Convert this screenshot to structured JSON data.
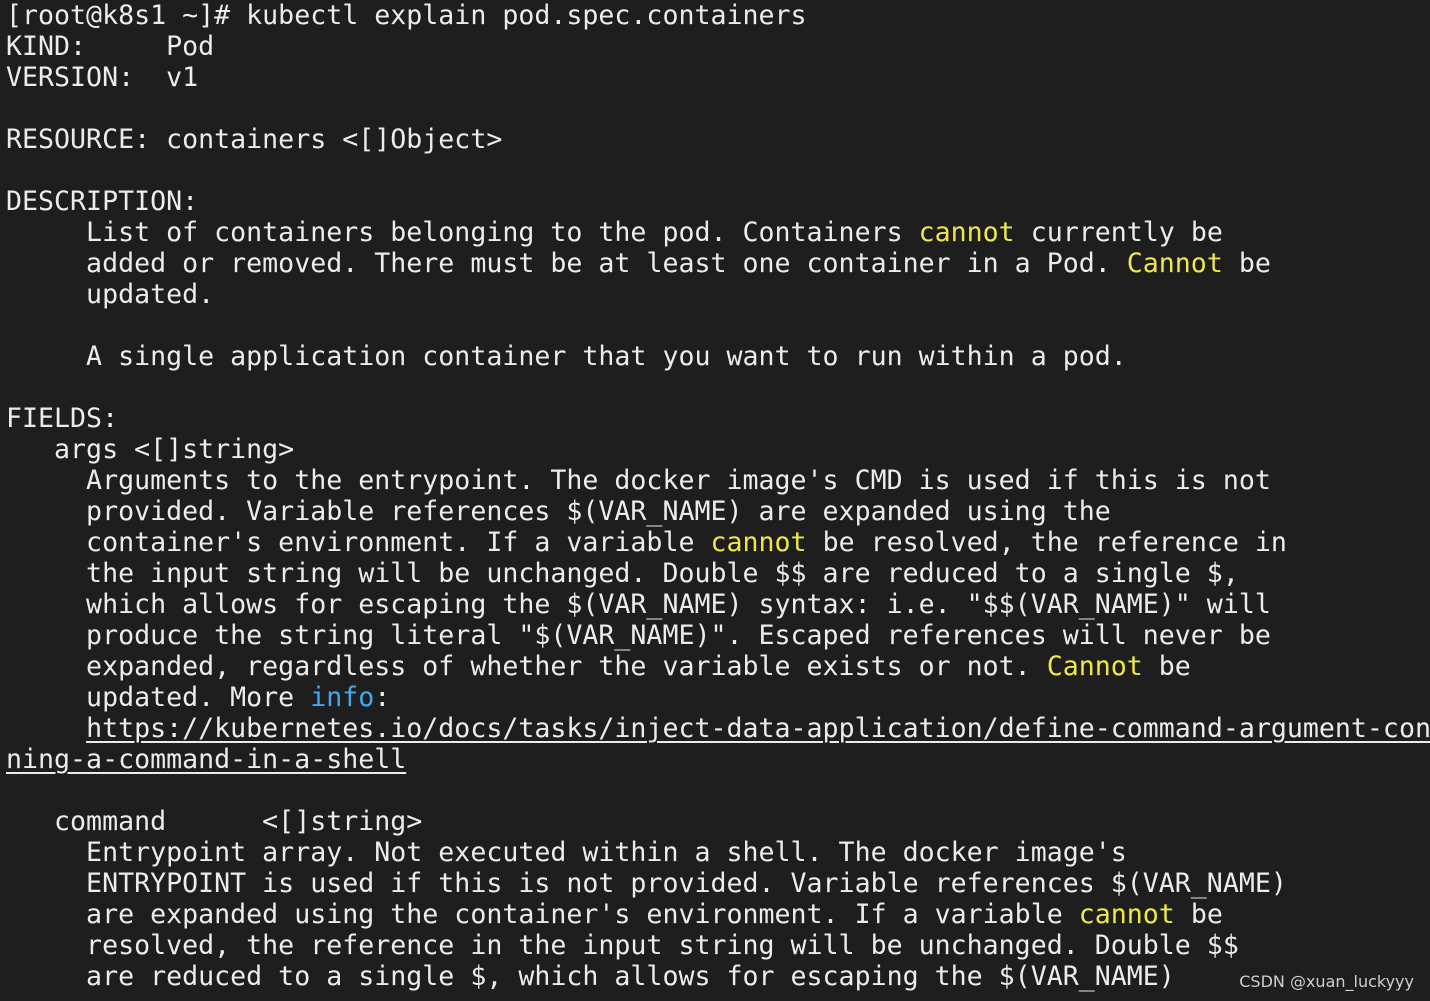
{
  "colors": {
    "background": "#1e1e1e",
    "foreground": "#ececec",
    "highlight_yellow": "#f0e64a",
    "highlight_blue": "#3fa9f5"
  },
  "terminal": {
    "lines": [
      {
        "segments": [
          {
            "text": "[root@k8s1 ~]# kubectl explain pod.spec.containers"
          }
        ]
      },
      {
        "segments": [
          {
            "text": "KIND:     Pod"
          }
        ]
      },
      {
        "segments": [
          {
            "text": "VERSION:  v1"
          }
        ]
      },
      {
        "segments": []
      },
      {
        "segments": [
          {
            "text": "RESOURCE: containers <[]Object>"
          }
        ]
      },
      {
        "segments": []
      },
      {
        "segments": [
          {
            "text": "DESCRIPTION:"
          }
        ]
      },
      {
        "segments": [
          {
            "text": "     List of containers belonging to the pod. Containers "
          },
          {
            "text": "cannot",
            "hl": "yellow"
          },
          {
            "text": " currently be"
          }
        ]
      },
      {
        "segments": [
          {
            "text": "     added or removed. There must be at least one container in a Pod. "
          },
          {
            "text": "Cannot",
            "hl": "yellow"
          },
          {
            "text": " be"
          }
        ]
      },
      {
        "segments": [
          {
            "text": "     updated."
          }
        ]
      },
      {
        "segments": []
      },
      {
        "segments": [
          {
            "text": "     A single application container that you want to run within a pod."
          }
        ]
      },
      {
        "segments": []
      },
      {
        "segments": [
          {
            "text": "FIELDS:"
          }
        ]
      },
      {
        "segments": [
          {
            "text": "   args <[]string>"
          }
        ]
      },
      {
        "segments": [
          {
            "text": "     Arguments to the entrypoint. The docker image's CMD is used if this is not"
          }
        ]
      },
      {
        "segments": [
          {
            "text": "     provided. Variable references $(VAR_NAME) are expanded using the"
          }
        ]
      },
      {
        "segments": [
          {
            "text": "     container's environment. If a variable "
          },
          {
            "text": "cannot",
            "hl": "yellow"
          },
          {
            "text": " be resolved, the reference in"
          }
        ]
      },
      {
        "segments": [
          {
            "text": "     the input string will be unchanged. Double $$ are reduced to a single $,"
          }
        ]
      },
      {
        "segments": [
          {
            "text": "     which allows for escaping the $(VAR_NAME) syntax: i.e. \"$$(VAR_NAME)\" will"
          }
        ]
      },
      {
        "segments": [
          {
            "text": "     produce the string literal \"$(VAR_NAME)\". Escaped references will never be"
          }
        ]
      },
      {
        "segments": [
          {
            "text": "     expanded, regardless of whether the variable exists or not. "
          },
          {
            "text": "Cannot",
            "hl": "yellow"
          },
          {
            "text": " be"
          }
        ]
      },
      {
        "segments": [
          {
            "text": "     updated. More "
          },
          {
            "text": "info",
            "hl": "blue"
          },
          {
            "text": ":"
          }
        ]
      },
      {
        "segments": [
          {
            "text": "     "
          },
          {
            "text": "https://kubernetes.io/docs/tasks/inject-data-application/define-command-argument-con",
            "link": true
          }
        ]
      },
      {
        "segments": [
          {
            "text": "ning-a-command-in-a-shell",
            "link": true
          }
        ]
      },
      {
        "segments": []
      },
      {
        "segments": [
          {
            "text": "   command      <[]string>"
          }
        ]
      },
      {
        "segments": [
          {
            "text": "     Entrypoint array. Not executed within a shell. The docker image's"
          }
        ]
      },
      {
        "segments": [
          {
            "text": "     ENTRYPOINT is used if this is not provided. Variable references $(VAR_NAME)"
          }
        ]
      },
      {
        "segments": [
          {
            "text": "     are expanded using the container's environment. If a variable "
          },
          {
            "text": "cannot",
            "hl": "yellow"
          },
          {
            "text": " be"
          }
        ]
      },
      {
        "segments": [
          {
            "text": "     resolved, the reference in the input string will be unchanged. Double $$"
          }
        ]
      },
      {
        "segments": [
          {
            "text": "     are reduced to a single $, which allows for escaping the $(VAR_NAME)"
          }
        ]
      }
    ]
  },
  "watermark": "CSDN @xuan_luckyyy"
}
